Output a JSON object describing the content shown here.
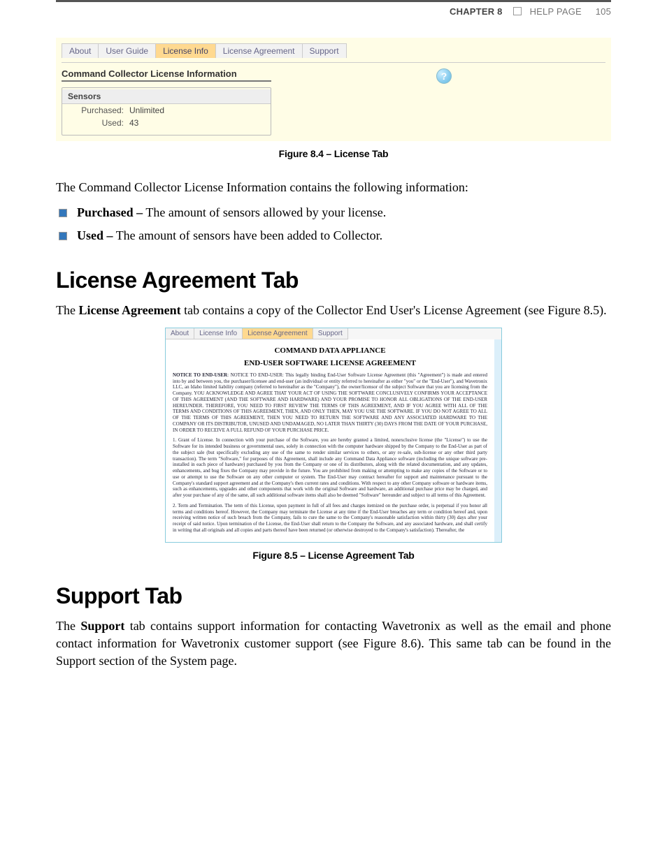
{
  "header": {
    "chapter": "CHAPTER 8",
    "pagelabel": "HELP PAGE",
    "pagenum": "105"
  },
  "shot1": {
    "tabs": [
      "About",
      "User Guide",
      "License Info",
      "License Agreement",
      "Support"
    ],
    "section_title": "Command Collector License Information",
    "panel_title": "Sensors",
    "purchased_k": "Purchased:",
    "purchased_v": "Unlimited",
    "used_k": "Used:",
    "used_v": "43",
    "help_icon": "?"
  },
  "caption1": "Figure 8.4 – License Tab",
  "intro": "The Command Collector License Information contains the following information:",
  "bullets": {
    "b1_strong": "Purchased –",
    "b1_rest": " The amount of sensors allowed by your license.",
    "b2_strong": "Used –",
    "b2_rest": " The amount of sensors have been added to Collector."
  },
  "h_license": "License Agreement Tab",
  "license_p_pre": "The ",
  "license_p_strong": "License Agreement",
  "license_p_post": " tab contains a copy of the Collector End User's License Agreement (see Figure 8.5).",
  "shot2": {
    "tabs": [
      "About",
      "License Info",
      "License Agreement",
      "Support"
    ],
    "title_a": "COMMAND DATA APPLIANCE",
    "title_b": "END-USER SOFTWARE LICENSE AGREEMENT",
    "para1": "NOTICE TO END-USER: This legally binding End-User Software License Agreement (this \"Agreement\") is made and entered into by and between you, the purchaser/licensee and end-user (an individual or entity referred to hereinafter as either \"you\" or the \"End-User\"), and Wavetronix LLC, an Idaho limited liability company (referred to hereinafter as the \"Company\"), the owner/licensor of the subject Software that you are licensing from the Company. YOU ACKNOWLEDGE AND AGREE THAT YOUR ACT OF USING THE SOFTWARE CONCLUSIVELY CONFIRMS YOUR ACCEPTANCE OF THIS AGREEMENT (AND THE SOFTWARE AND HARDWARE) AND YOUR PROMISE TO HONOR ALL OBLIGATIONS OF THE END-USER HEREUNDER. THEREFORE, YOU NEED TO FIRST REVIEW THE TERMS OF THIS AGREEMENT, AND IF YOU AGREE WITH ALL OF THE TERMS AND CONDITIONS OF THIS AGREEMENT, THEN, AND ONLY THEN, MAY YOU USE THE SOFTWARE. IF YOU DO NOT AGREE TO ALL OF THE TERMS OF THIS AGREEMENT, THEN YOU NEED TO RETURN THE SOFTWARE AND ANY ASSOCIATED HARDWARE TO THE COMPANY OR ITS DISTRIBUTOR, UNUSED AND UNDAMAGED, NO LATER THAN THIRTY (30) DAYS FROM THE DATE OF YOUR PURCHASE, IN ORDER TO RECEIVE A FULL REFUND OF YOUR PURCHASE PRICE.",
    "para2": "1. Grant of License. In connection with your purchase of the Software, you are hereby granted a limited, nonexclusive license (the \"License\") to use the Software for its intended business or governmental uses, solely in connection with the computer hardware shipped by the Company to the End-User as part of the subject sale (but specifically excluding any use of the same to render similar services to others, or any re-sale, sub-license or any other third party transaction). The term \"Software,\" for purposes of this Agreement, shall include any Command Data Appliance software (including the unique software pre-installed in each piece of hardware) purchased by you from the Company or one of its distributors, along with the related documentation, and any updates, enhancements, and bug fixes the Company may provide in the future. You are prohibited from making or attempting to make any copies of the Software or to use or attempt to use the Software on any other computer or system. The End-User may contract hereafter for support and maintenance pursuant to the Company's standard support agreement and at the Company's then current rates and conditions. With respect to any other Company software or hardware items, such as enhancements, upgrades and other components that work with the original Software and hardware, an additional purchase price may be charged, and after your purchase of any of the same, all such additional software items shall also be deemed \"Software\" hereunder and subject to all terms of this Agreement.",
    "para3": "2. Term and Termination. The term of this License, upon payment in full of all fees and charges itemized on the purchase order, is perpetual if you honor all terms and conditions hereof. However, the Company may terminate the License at any time if the End-User breaches any term or condition hereof and, upon receiving written notice of such breach from the Company, fails to cure the same to the Company's reasonable satisfaction within thirty (30) days after your receipt of said notice. Upon termination of the License, the End-User shall return to the Company the Software, and any associated hardware, and shall certify in writing that all originals and all copies and parts thereof have been returned (or otherwise destroyed to the Company's satisfaction). Thereafter, the"
  },
  "caption2": "Figure 8.5 – License Agreement Tab",
  "h_support": "Support Tab",
  "support_p_pre": "The ",
  "support_p_strong": "Support",
  "support_p_post": " tab contains support information for contacting Wavetronix as well as the email and phone contact information for Wavetronix customer support (see Figure 8.6). This same tab can be found in the Support section of the System page."
}
